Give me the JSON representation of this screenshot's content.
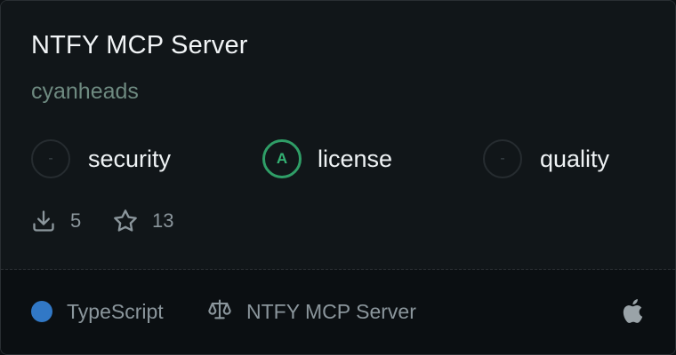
{
  "card": {
    "title": "NTFY MCP Server",
    "author": "cyanheads"
  },
  "scores": [
    {
      "grade": "-",
      "label": "security",
      "status": "none"
    },
    {
      "grade": "A",
      "label": "license",
      "status": "good"
    },
    {
      "grade": "-",
      "label": "quality",
      "status": "none"
    }
  ],
  "stats": {
    "downloads": "5",
    "stars": "13"
  },
  "footer": {
    "language": "TypeScript",
    "language_color": "#3178c6",
    "license_name": "NTFY MCP Server",
    "platform_icon": "apple-icon"
  },
  "colors": {
    "grade_good": "#2f9e67",
    "accent_text": "#6e8a80"
  }
}
